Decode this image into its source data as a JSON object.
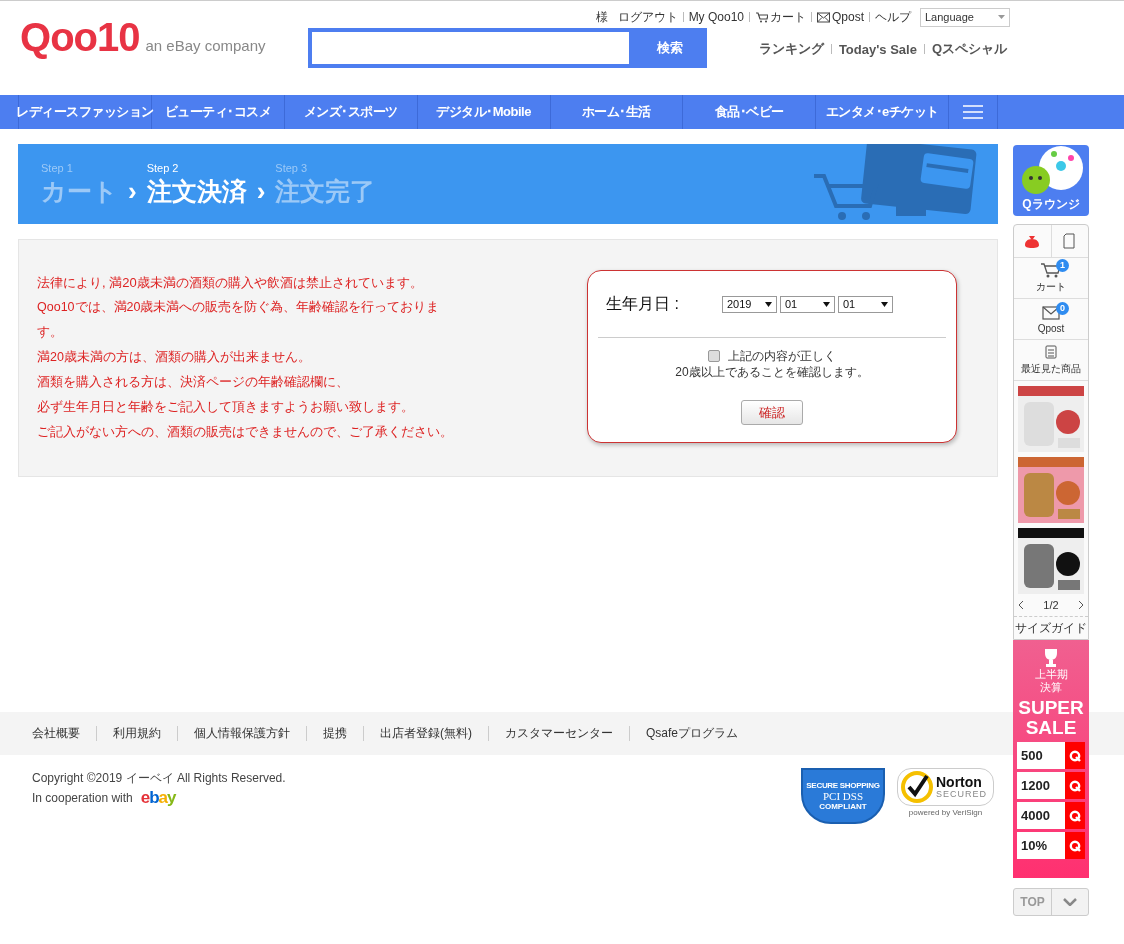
{
  "header": {
    "logo": {
      "name": "Qoo10",
      "tagline": "an eBay company"
    },
    "user_links": [
      {
        "kind": "text",
        "label": "様"
      },
      {
        "kind": "link",
        "label": "ログアウト"
      },
      {
        "kind": "link",
        "label": "My Qoo10"
      },
      {
        "kind": "cart",
        "label": "カート"
      },
      {
        "kind": "mail",
        "label": "Qpost"
      },
      {
        "kind": "link",
        "label": "ヘルプ"
      }
    ],
    "language": {
      "value": "Language"
    },
    "search": {
      "button": "検索"
    },
    "quick_links": [
      "ランキング",
      "Today's Sale",
      "Qスペシャル"
    ]
  },
  "categories": [
    "レディースファッション",
    "ビューティ･コスメ",
    "メンズ･スポーツ",
    "デジタル･Mobile",
    "ホーム･生活",
    "食品･ベビー",
    "エンタメ･eチケット"
  ],
  "steps": [
    {
      "step": "Step 1",
      "name": "カート",
      "selected": false
    },
    {
      "step": "Step 2",
      "name": "注文決済",
      "selected": true
    },
    {
      "step": "Step 3",
      "name": "注文完了",
      "selected": false
    }
  ],
  "step_separator": "›",
  "notice": {
    "lines": [
      "法律により, 満20歳未満の酒類の購入や飲酒は禁止されています。",
      "Qoo10では、満20歳未満への販売を防ぐ為、年齢確認を行っておりま",
      "す。",
      "満20歳未満の方は、酒類の購入が出来ません。",
      "酒類を購入される方は、決済ページの年齢確認欄に、",
      "必ず生年月日と年齢をご記入して頂きますようお願い致します。",
      "ご記入がない方への、酒類の販売はできませんので、ご了承ください。"
    ]
  },
  "age_check": {
    "label": "生年月日 :",
    "year": "2019",
    "month": "01",
    "day": "01",
    "checked": false,
    "confirm_text": [
      "上記の内容が正しく",
      "20歳以上であることを確認します。"
    ],
    "button": "確認"
  },
  "footer": {
    "links": [
      "会社概要",
      "利用規約",
      "個人情報保護方針",
      "提携",
      "出店者登録(無料)",
      "カスタマーセンター",
      "Qsafeプログラム"
    ],
    "copyright": "Copyright ©2019 イーベイ All Rights Reserved.",
    "cooperation": "In cooperation with",
    "partner_logo": "ebay",
    "pci_badge": {
      "top": "SECURE SHOPPING",
      "main": "PCI DSS",
      "bottom": "COMPLIANT"
    },
    "norton_badge": {
      "name": "Norton",
      "status": "SECURED",
      "powered": "powered by VeriSign"
    }
  },
  "sidebar": {
    "lounge": "Qラウンジ",
    "cart": {
      "label": "カート",
      "count": "1"
    },
    "qpost": {
      "label": "Qpost",
      "count": "0"
    },
    "recent": "最近見た商品",
    "pager": "1/2",
    "size_guide": "サイズガイド",
    "sale": {
      "title": "上半期決算",
      "headline": "SUPER SALE",
      "coupons": [
        "500",
        "1200",
        "4000",
        "10%"
      ]
    },
    "top": "TOP"
  }
}
